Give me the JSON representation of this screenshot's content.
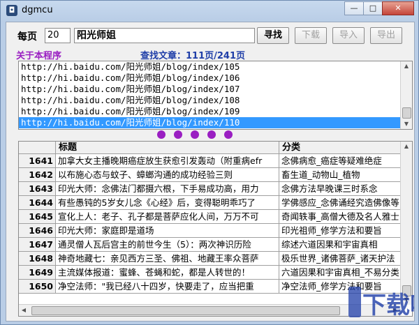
{
  "window": {
    "title": "dgmcu",
    "app_icon": "app-icon",
    "controls": [
      "minimize-icon",
      "maximize-icon",
      "close-icon"
    ],
    "minimize_glyph": "—",
    "maximize_glyph": "□",
    "close_glyph": "✕"
  },
  "search": {
    "per_page_label": "每页",
    "per_page_value": "20",
    "query_value": "阳光师姐",
    "find_label": "寻找",
    "download_label": "下载",
    "import_label": "导入",
    "export_label": "导出"
  },
  "about_label": "关于本程序",
  "status_text": "查找文章：111页/241页",
  "url_list": {
    "items": [
      "http://hi.baidu.com/阳光师姐/blog/index/105",
      "http://hi.baidu.com/阳光师姐/blog/index/106",
      "http://hi.baidu.com/阳光师姐/blog/index/107",
      "http://hi.baidu.com/阳光师姐/blog/index/108",
      "http://hi.baidu.com/阳光师姐/blog/index/109",
      "http://hi.baidu.com/阳光师姐/blog/index/110"
    ],
    "selected_index": 5
  },
  "progress_dots": 5,
  "table": {
    "columns": [
      "",
      "标题",
      "分类"
    ],
    "rows": [
      [
        "1641",
        "加拿大女主播晚期癌症放生获愈引发轰动（附重病efr",
        "念佛病愈_癌症等疑难绝症"
      ],
      [
        "1642",
        "以布施心态与蚊子、蟑螂沟通的成功经验三则",
        "畜生道_动物山_植物"
      ],
      [
        "1643",
        "印光大师：念佛法门都摄六根，下手易成功高，用力",
        "念佛方法早晚课三时系念"
      ],
      [
        "1644",
        "有些愚钝的5岁女儿念《心经》后，变得聪明乖巧了",
        "学佛感应_念佛诵经究造佛像等"
      ],
      [
        "1645",
        "宣化上人：老子、孔子都是菩萨应化人间，万万不可",
        "奇闻轶事_高僧大德及名人雅士"
      ],
      [
        "1646",
        "印光大师：家庭即是道场",
        "印光祖师_修学方法和要旨"
      ],
      [
        "1647",
        "通灵僧人瓦后宫主的前世今生（5）：两次神识历险",
        "综述六道因果和宇宙真相"
      ],
      [
        "1648",
        "神奇地藏七：亲见西方三圣、佛祖、地藏王率众菩萨",
        "极乐世界_诸佛菩萨_诸天护法"
      ],
      [
        "1649",
        "主流媒体报道：蜜蜂、苍蝇和蛇，都是人转世的！",
        "六道因果和宇宙真相_不易分类"
      ],
      [
        "1650",
        "净空法师：\"我已经八十四岁，快要走了，应当把重",
        "净空法师_修学方法和要旨"
      ]
    ]
  },
  "colors": {
    "accent_purple": "#9a1fc2",
    "status_blue": "#1f3ea8",
    "selection": "#3399ff",
    "close_red": "#c4443a"
  },
  "watermark_text": "下载吧"
}
